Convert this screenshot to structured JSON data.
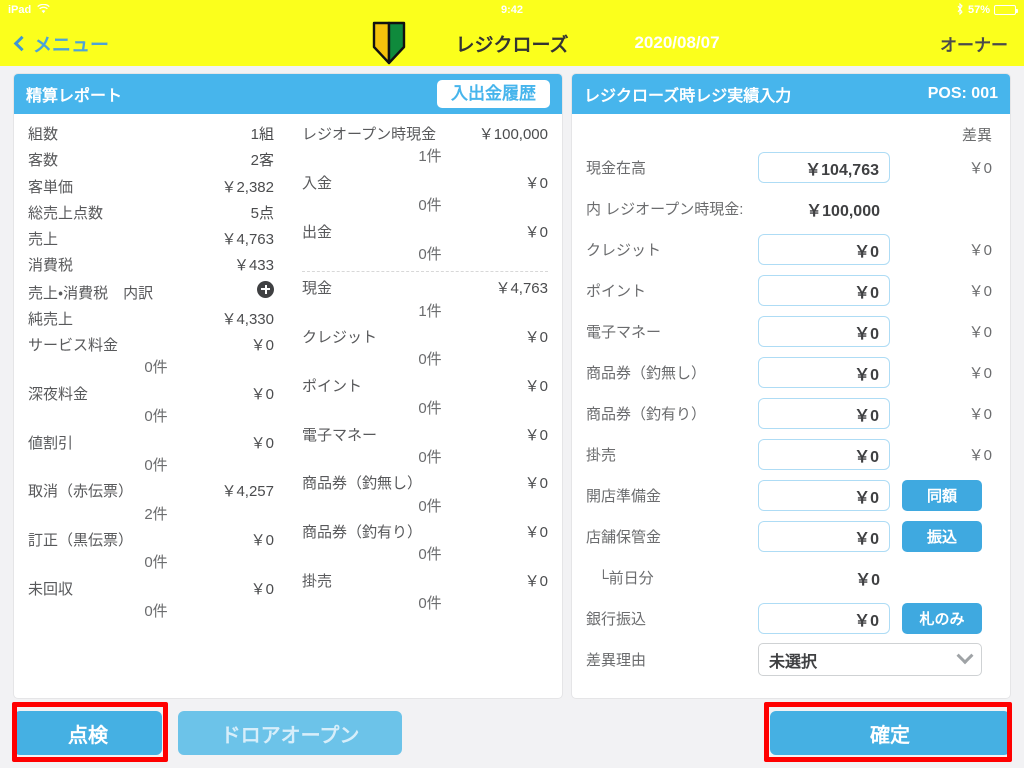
{
  "status_bar": {
    "device": "iPad",
    "wifi_icon": "wifi-icon",
    "time": "9:42",
    "bluetooth_icon": "bluetooth-icon",
    "battery_percent": "57%",
    "battery_level": 57
  },
  "navbar": {
    "back_label": "メニュー",
    "logo_icon": "beginner-driver-mark-icon",
    "title": "レジクローズ",
    "date": "2020/08/07",
    "user": "オーナー"
  },
  "report_panel": {
    "title": "精算レポート",
    "history_button": "入出金履歴",
    "left_column": [
      {
        "label": "組数",
        "value": "1組"
      },
      {
        "label": "客数",
        "value": "2客"
      },
      {
        "label": "客単価",
        "value": "￥2,382"
      },
      {
        "label": "総売上点数",
        "value": "5点"
      },
      {
        "label": "売上",
        "value": "￥4,763"
      },
      {
        "label": "消費税",
        "value": "￥433"
      },
      {
        "label": "売上・消費税　内訳",
        "value": "",
        "icon": "plus-circle-icon"
      },
      {
        "label": "純売上",
        "value": "￥4,330"
      },
      {
        "label": "サービス料金",
        "value": "￥0",
        "count": "0件"
      },
      {
        "label": "深夜料金",
        "value": "￥0",
        "count": "0件"
      },
      {
        "label": "値割引",
        "value": "￥0",
        "count": "0件"
      },
      {
        "label": "取消（赤伝票）",
        "value": "￥4,257",
        "count": "2件"
      },
      {
        "label": "訂正（黒伝票）",
        "value": "￥0",
        "count": "0件"
      },
      {
        "label": "未回収",
        "value": "￥0",
        "count": "0件"
      }
    ],
    "middle_column": [
      {
        "label": "レジオープン時現金",
        "value": "￥100,000",
        "count": "1件"
      },
      {
        "label": "入金",
        "value": "￥0",
        "count": "0件"
      },
      {
        "label": "出金",
        "value": "￥0",
        "count": "0件",
        "divider_after": true
      },
      {
        "label": "現金",
        "value": "￥4,763",
        "count": "1件"
      },
      {
        "label": "クレジット",
        "value": "￥0",
        "count": "0件"
      },
      {
        "label": "ポイント",
        "value": "￥0",
        "count": "0件"
      },
      {
        "label": "電子マネー",
        "value": "￥0",
        "count": "0件"
      },
      {
        "label": "商品券（釣無し）",
        "value": "￥0",
        "count": "0件"
      },
      {
        "label": "商品券（釣有り）",
        "value": "￥0",
        "count": "0件"
      },
      {
        "label": "掛売",
        "value": "￥0",
        "count": "0件"
      }
    ]
  },
  "input_panel": {
    "title": "レジクローズ時レジ実績入力",
    "pos": "POS: 001",
    "diff_header": "差異",
    "rows": [
      {
        "label": "現金在高",
        "type": "input",
        "value": "￥104,763",
        "diff": "￥0"
      },
      {
        "label": "内 レジオープン時現金:",
        "type": "static",
        "value": "￥100,000",
        "diff": ""
      },
      {
        "label": "クレジット",
        "type": "input",
        "value": "￥0",
        "diff": "￥0"
      },
      {
        "label": "ポイント",
        "type": "input",
        "value": "￥0",
        "diff": "￥0"
      },
      {
        "label": "電子マネー",
        "type": "input",
        "value": "￥0",
        "diff": "￥0"
      },
      {
        "label": "商品券（釣無し）",
        "type": "input",
        "value": "￥0",
        "diff": "￥0"
      },
      {
        "label": "商品券（釣有り）",
        "type": "input",
        "value": "￥0",
        "diff": "￥0"
      },
      {
        "label": "掛売",
        "type": "input",
        "value": "￥0",
        "diff": "￥0"
      },
      {
        "label": "開店準備金",
        "type": "input",
        "value": "￥0",
        "diff": "",
        "button": "同額"
      },
      {
        "label": "店舗保管金",
        "type": "input",
        "value": "￥0",
        "diff": "",
        "button": "振込"
      },
      {
        "label": "└前日分",
        "type": "static",
        "value": "￥0",
        "diff": "",
        "indent": true
      },
      {
        "label": "銀行振込",
        "type": "input",
        "value": "￥0",
        "diff": "",
        "button": "札のみ"
      },
      {
        "label": "差異理由",
        "type": "select",
        "value": "未選択",
        "options": [
          "未選択"
        ]
      }
    ]
  },
  "footer": {
    "inspect_button": "点検",
    "drawer_open_button": "ドロアオープン",
    "confirm_button": "確定",
    "highlight_color": "#ff0000"
  },
  "colors": {
    "navbar": "#fbff1c",
    "panel_header": "#47b5ec",
    "accent_button": "#45b0e3",
    "field_border": "#aedcf5",
    "page_background": "#f2f2f4"
  }
}
